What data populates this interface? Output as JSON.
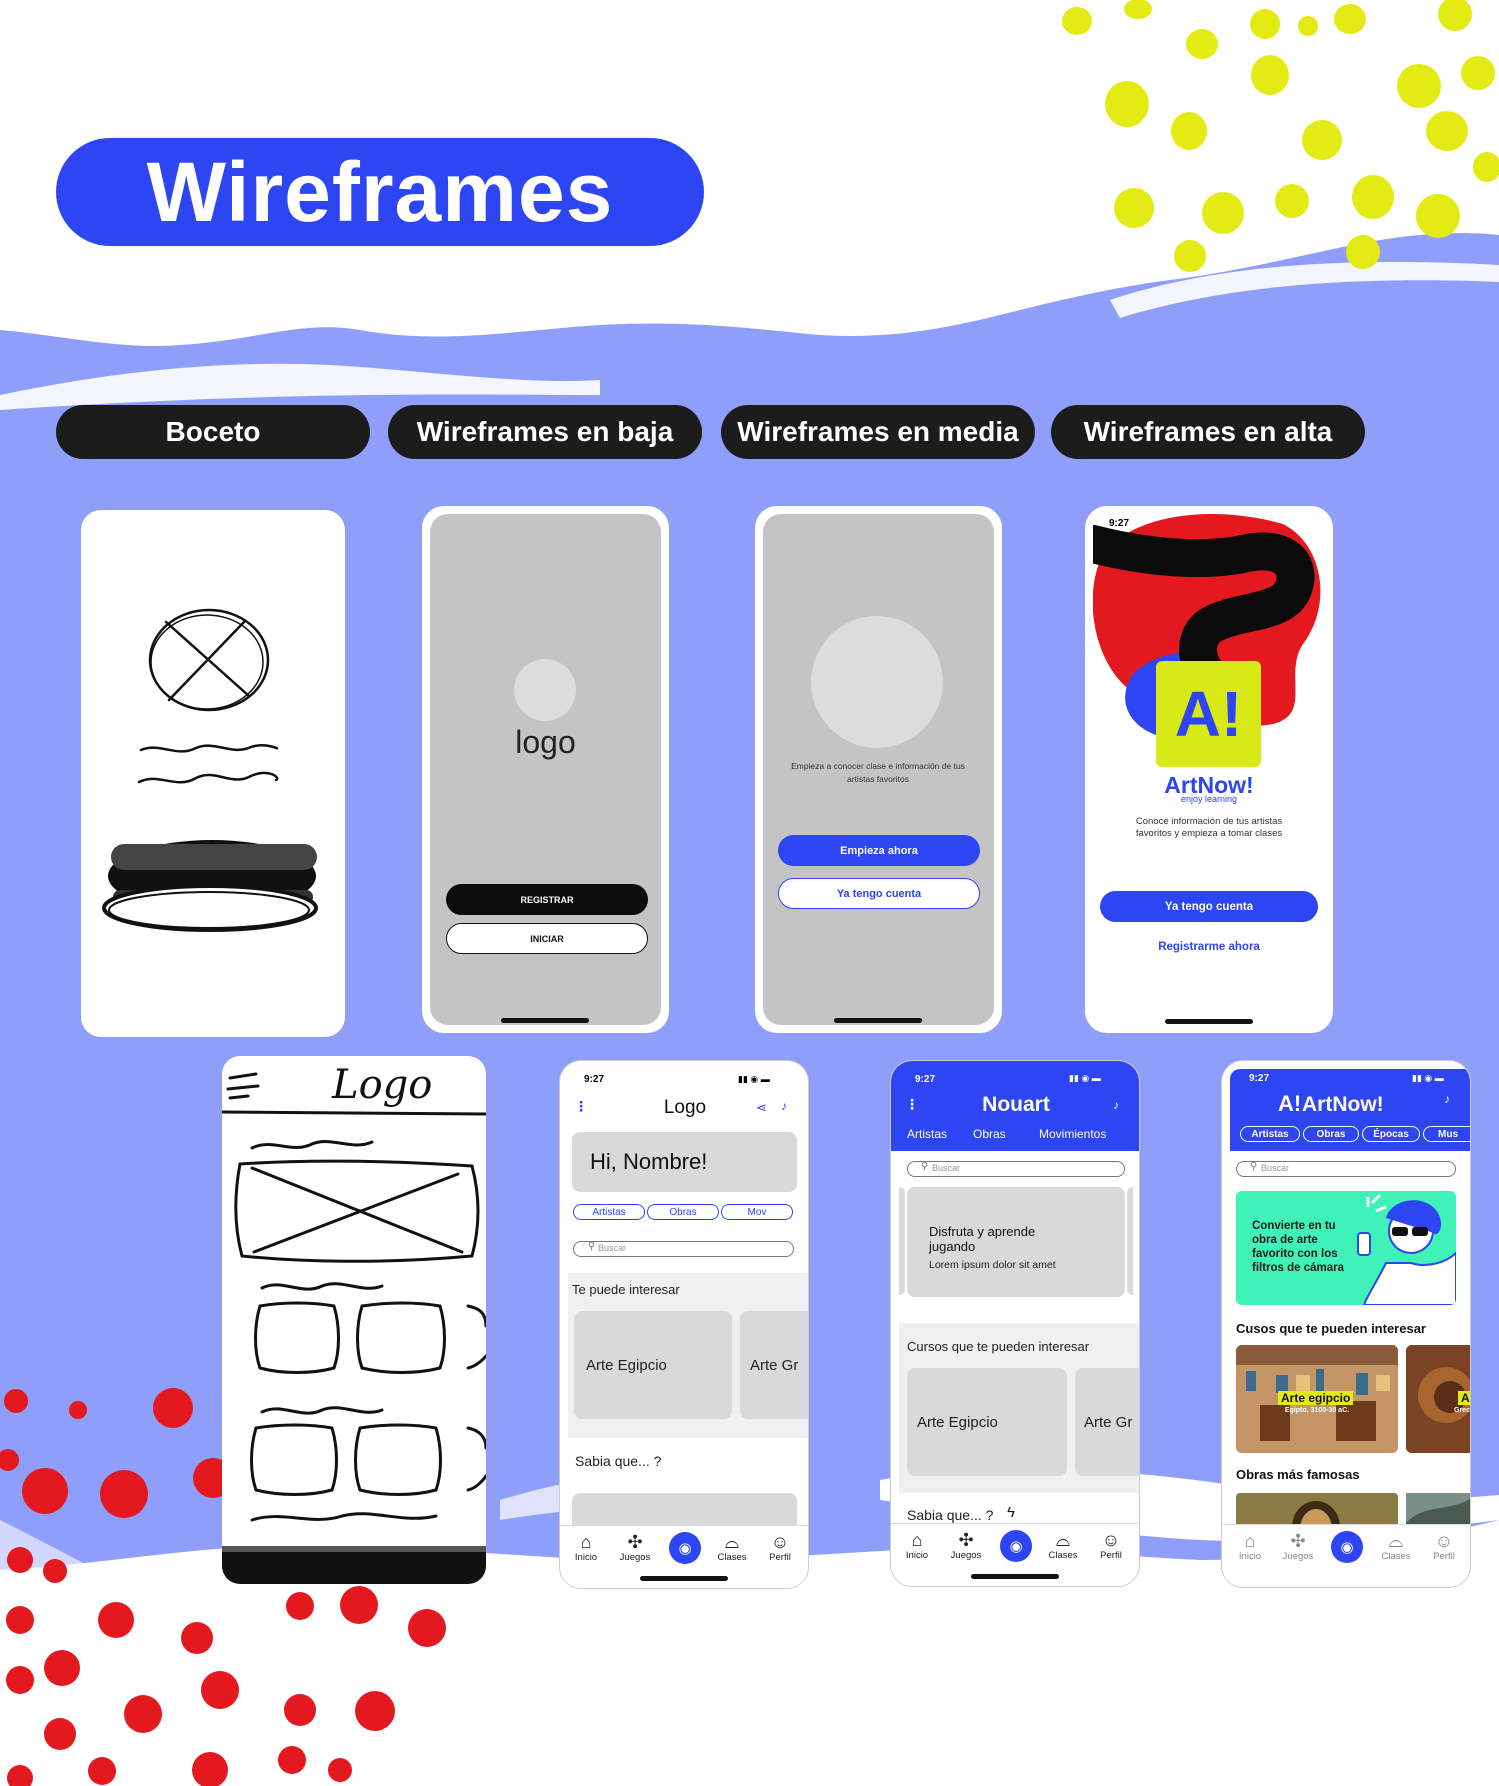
{
  "page": {
    "title": "Wireframes",
    "colors": {
      "brand_blue": "#2d45f2",
      "periwinkle": "#8f9ff9",
      "lime": "#e4ea13",
      "red": "#e4191f",
      "dark": "#1c1c1c",
      "mint": "#3ef2b8"
    }
  },
  "categories": [
    "Boceto",
    "Wireframes en baja",
    "Wireframes en media",
    "Wireframes en alta"
  ],
  "low_onboarding": {
    "logo_text": "logo",
    "register_label": "REGISTRAR",
    "login_label": "INICIAR"
  },
  "mid_onboarding": {
    "description": "Empieza a conocer clase e información de tus artistas favoritos",
    "primary_label": "Empieza ahora",
    "secondary_label": "Ya tengo cuenta"
  },
  "high_onboarding": {
    "time": "9:27",
    "brand_name": "ArtNow!",
    "brand_mark": "A!",
    "tagline": "enjoy learning",
    "description": "Conoce información de tus artistas favoritos y empieza a tomar clases",
    "primary_label": "Ya tengo cuenta",
    "secondary_label": "Registrarme ahora"
  },
  "sketch_home": {
    "logo_text": "Logo"
  },
  "low_home": {
    "time": "9:27",
    "logo_text": "Logo",
    "greeting": "Hi, Nombre!",
    "chips": [
      "Artistas",
      "Obras",
      "Mov"
    ],
    "search_placeholder": "Buscar",
    "section_title": "Te puede interesar",
    "cards": [
      "Arte Egipcio",
      "Arte Gr"
    ],
    "did_you_know": "Sabia que... ?"
  },
  "mid_home": {
    "time": "9:27",
    "app_name": "Nouart",
    "tabs": [
      "Artistas",
      "Obras",
      "Movimientos"
    ],
    "search_placeholder": "Buscar",
    "banner_title": "Disfruta y aprende jugando",
    "banner_text": "Lorem ipsum dolor sit amet",
    "section_title": "Cursos que te pueden interesar",
    "cards": [
      "Arte Egipcio",
      "Arte Gr"
    ],
    "did_you_know": "Sabia que... ?"
  },
  "high_home": {
    "time": "9:27",
    "app_name": "ArtNow!",
    "brand_mark": "A!",
    "chips": [
      "Artistas",
      "Obras",
      "Épocas",
      "Mus"
    ],
    "search_placeholder": "Buscar",
    "promo_text": "Convierte en tu obra de arte favorito con los filtros de cámara",
    "courses_title": "Cusos que te pueden interesar",
    "course1_title": "Arte egipcio",
    "course1_sub": "Egipto, 3100-30 aC.",
    "course2_title": "Ar",
    "course2_sub": "Grec",
    "famous_title": "Obras más famosas"
  },
  "tabbar": [
    "Inicio",
    "Juegos",
    "Clases",
    "Perfil"
  ]
}
